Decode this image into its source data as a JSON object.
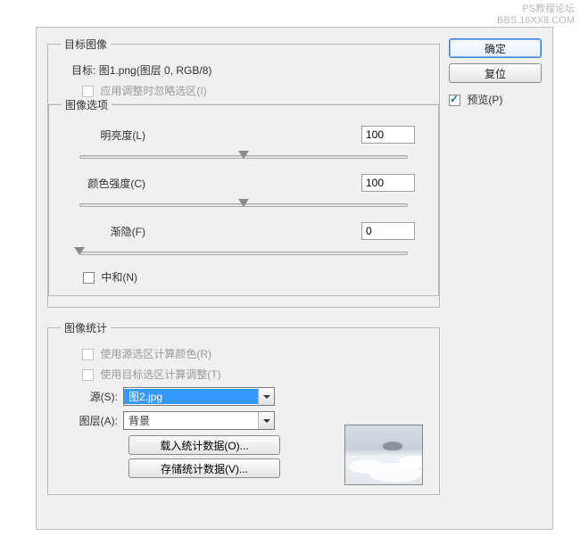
{
  "watermark": {
    "line1": "PS教程论坛",
    "line2": "BBS.16XX8.COM"
  },
  "groups": {
    "target_image": "目标图像",
    "image_options": "图像选项",
    "image_stats": "图像统计"
  },
  "target": {
    "label": "目标:",
    "value": "图1.png(图层 0, RGB/8)",
    "ignore_selection": "应用调整时忽略选区(I)"
  },
  "options": {
    "luminance": {
      "label": "明亮度(L)",
      "value": "100",
      "pos": 50
    },
    "color_intensity": {
      "label": "颜色强度(C)",
      "value": "100",
      "pos": 50
    },
    "fade": {
      "label": "渐隐(F)",
      "value": "0",
      "pos": 0
    },
    "neutralize": "中和(N)"
  },
  "stats": {
    "use_source_sel": "使用源选区计算颜色(R)",
    "use_target_sel": "使用目标选区计算调整(T)",
    "source_label": "源(S):",
    "source_value": "图2.jpg",
    "layer_label": "图层(A):",
    "layer_value": "背景",
    "load": "载入统计数据(O)...",
    "save": "存储统计数据(V)..."
  },
  "side": {
    "ok": "确定",
    "reset": "复位",
    "preview": "预览(P)"
  }
}
